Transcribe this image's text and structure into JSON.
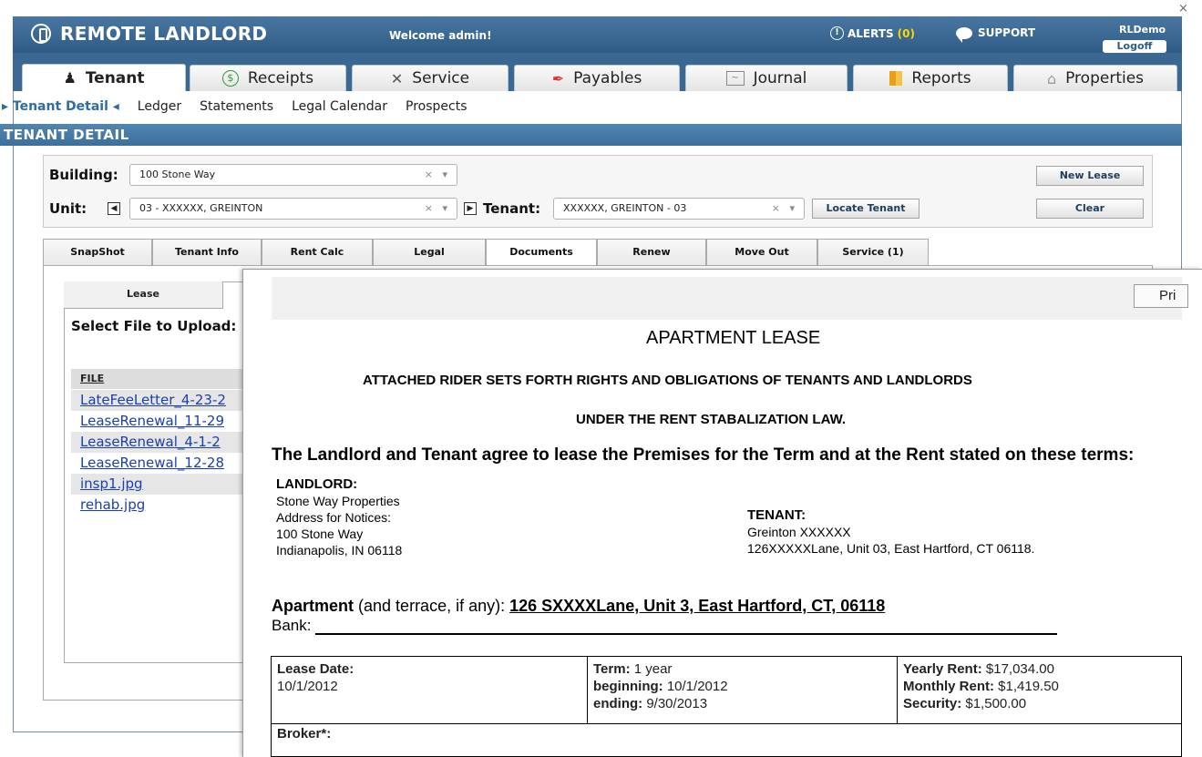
{
  "window": {
    "close_glyph": "×"
  },
  "header": {
    "logo": "REMOTE LANDLORD",
    "welcome": "Welcome admin!",
    "alerts_label": "ALERTS",
    "alerts_count": "(0)",
    "support_label": "SUPPORT",
    "account": "RLDemo",
    "logoff": "Logoff"
  },
  "main_tabs": [
    {
      "label": "Tenant",
      "icon": "person-icon"
    },
    {
      "label": "Receipts",
      "icon": "dollar-icon"
    },
    {
      "label": "Service",
      "icon": "tools-icon"
    },
    {
      "label": "Payables",
      "icon": "pen-icon"
    },
    {
      "label": "Journal",
      "icon": "chart-icon"
    },
    {
      "label": "Reports",
      "icon": "report-icon"
    },
    {
      "label": "Properties",
      "icon": "house-icon"
    }
  ],
  "subnav": [
    "▸ Tenant Detail ◂",
    "Ledger",
    "Statements",
    "Legal Calendar",
    "Prospects"
  ],
  "section_title": "TENANT DETAIL",
  "filter": {
    "building_label": "Building:",
    "building_value": "100 Stone Way",
    "unit_label": "Unit:",
    "unit_value": "03 - XXXXXX, GREINTON",
    "tenant_label": "Tenant:",
    "tenant_value": "XXXXXX, GREINTON - 03",
    "locate_button": "Locate Tenant",
    "new_lease_button": "New Lease",
    "clear_button": "Clear",
    "clear_glyph": "×",
    "dropdown_glyph": "▾"
  },
  "detail_tabs": [
    "SnapShot",
    "Tenant Info",
    "Rent Calc",
    "Legal",
    "Documents",
    "Renew",
    "Move Out",
    "Service (1)"
  ],
  "documents": {
    "sub_tab": "Lease",
    "upload_label": "Select File to Upload:",
    "file_header": "FILE",
    "files": [
      "LateFeeLetter_4-23-2",
      "LeaseRenewal_11-29",
      "LeaseRenewal_4-1-2",
      "LeaseRenewal_12-28",
      "insp1.jpg",
      "rehab.jpg"
    ]
  },
  "lease_doc": {
    "print_button": "Pri",
    "title": "APARTMENT LEASE",
    "subtitle1": "ATTACHED RIDER SETS FORTH RIGHTS AND OBLIGATIONS OF TENANTS AND LANDLORDS",
    "subtitle2": "UNDER THE RENT STABALIZATION LAW.",
    "agreement": "The Landlord and Tenant agree to lease the Premises for the Term and at the Rent stated on these terms:",
    "landlord_label": "LANDLORD:",
    "landlord_lines": [
      "Stone Way Properties",
      "Address for Notices:",
      "100 Stone Way",
      "Indianapolis, IN 06118"
    ],
    "tenant_label": "TENANT:",
    "tenant_lines": [
      "Greinton XXXXXX",
      "126XXXXXLane, Unit 03, East Hartford, CT 06118."
    ],
    "apartment_label": "Apartment",
    "apartment_note": "(and terrace, if any):",
    "apartment_value": "126 SXXXXLane, Unit 3, East Hartford, CT, 06118",
    "bank_label": "Bank:",
    "lease_date_label": "Lease Date:",
    "lease_date": "10/1/2012",
    "term_label": "Term:",
    "term": "1 year",
    "beginning_label": "beginning:",
    "beginning": "10/1/2012",
    "ending_label": "ending:",
    "ending": "9/30/2013",
    "yearly_rent_label": "Yearly Rent:",
    "yearly_rent": "$17,034.00",
    "monthly_rent_label": "Monthly Rent:",
    "monthly_rent": "$1,419.50",
    "security_label": "Security:",
    "security": "$1,500.00",
    "broker_label": "Broker*:"
  }
}
